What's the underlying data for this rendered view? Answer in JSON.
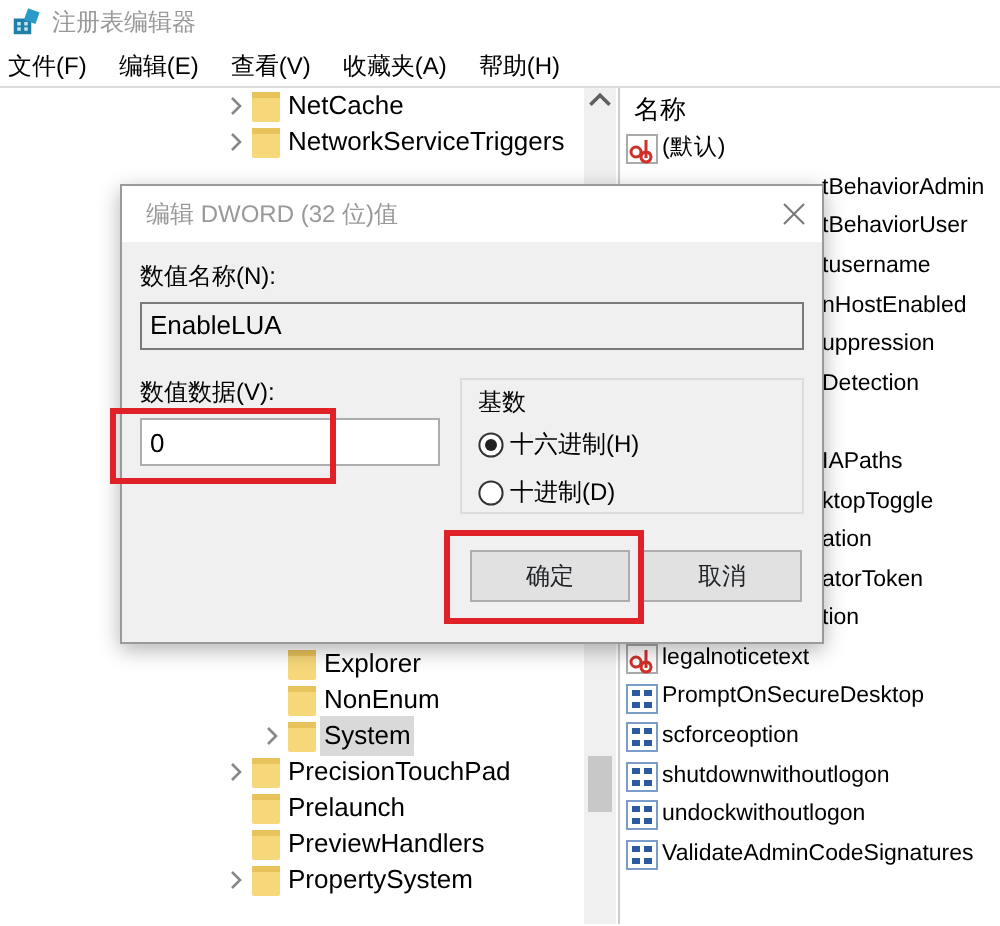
{
  "window": {
    "title": "注册表编辑器"
  },
  "menu": [
    "文件(F)",
    "编辑(E)",
    "查看(V)",
    "收藏夹(A)",
    "帮助(H)"
  ],
  "tree": {
    "items": [
      {
        "label": "NetCache",
        "expandable": true,
        "selected": false
      },
      {
        "label": "NetworkServiceTriggers",
        "expandable": true,
        "selected": false
      },
      {
        "children": [
          {
            "label": "Explorer",
            "expandable": false,
            "selected": false
          },
          {
            "label": "NonEnum",
            "expandable": false,
            "selected": false
          },
          {
            "label": "System",
            "expandable": true,
            "selected": true
          }
        ]
      },
      {
        "label": "PrecisionTouchPad",
        "expandable": true,
        "selected": false
      },
      {
        "label": "Prelaunch",
        "expandable": false,
        "selected": false
      },
      {
        "label": "PreviewHandlers",
        "expandable": false,
        "selected": false
      },
      {
        "label": "PropertySystem",
        "expandable": true,
        "selected": false
      }
    ]
  },
  "values": {
    "header": "名称",
    "rows": [
      {
        "kind": "string",
        "name": "(默认)"
      },
      {
        "kind": "partial",
        "name": "tBehaviorAdmin"
      },
      {
        "kind": "partial",
        "name": "tBehaviorUser"
      },
      {
        "kind": "partial",
        "name": "tusername"
      },
      {
        "kind": "partial",
        "name": "nHostEnabled"
      },
      {
        "kind": "partial",
        "name": "uppression"
      },
      {
        "kind": "partial",
        "name": "Detection"
      },
      {
        "kind": "partial"
      },
      {
        "kind": "partial",
        "name": "IAPaths"
      },
      {
        "kind": "partial",
        "name": "ktopToggle"
      },
      {
        "kind": "partial",
        "name": "ation"
      },
      {
        "kind": "partial",
        "name": "atorToken"
      },
      {
        "kind": "partial",
        "name": "tion"
      },
      {
        "kind": "string",
        "name": "legalnoticetext"
      },
      {
        "kind": "dword",
        "name": "PromptOnSecureDesktop"
      },
      {
        "kind": "dword",
        "name": "scforceoption"
      },
      {
        "kind": "dword",
        "name": "shutdownwithoutlogon"
      },
      {
        "kind": "dword",
        "name": "undockwithoutlogon"
      },
      {
        "kind": "dword",
        "name": "ValidateAdminCodeSignatures"
      }
    ]
  },
  "dialog": {
    "title": "编辑 DWORD (32 位)值",
    "name_label": "数值名称(N):",
    "name_value": "EnableLUA",
    "data_label": "数值数据(V):",
    "data_value": "0",
    "data_highlighted": true,
    "base_label": "基数",
    "bases": [
      {
        "label": "十六进制(H)",
        "selected": true
      },
      {
        "label": "十进制(D)",
        "selected": false
      }
    ],
    "buttons": [
      {
        "label": "确定",
        "highlighted": true
      },
      {
        "label": "取消",
        "highlighted": false
      }
    ]
  }
}
